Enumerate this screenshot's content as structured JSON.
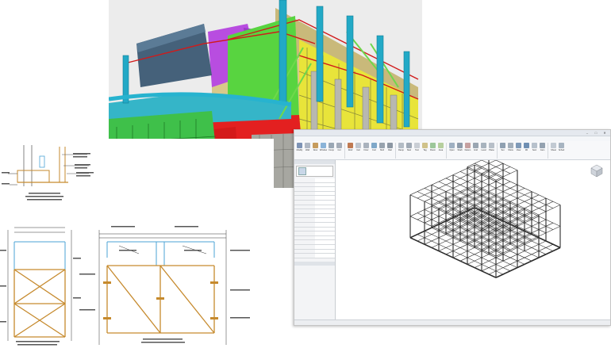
{
  "revit": {
    "title": "",
    "window_buttons": [
      "–",
      "□",
      "✕"
    ],
    "ribbon_tabs": [],
    "tools": [
      {
        "icon": "modify-icon",
        "label": "Modify",
        "color": "#7d93b5"
      },
      {
        "icon": "wall-icon",
        "label": "Wall",
        "color": "#b0b8c4"
      },
      {
        "icon": "door-icon",
        "label": "Door",
        "color": "#c69c5d"
      },
      {
        "icon": "window-icon",
        "label": "Window",
        "color": "#8ab3d8"
      },
      {
        "icon": "component-icon",
        "label": "Comp",
        "color": "#9aa7b4"
      },
      {
        "icon": "column-icon",
        "label": "Col",
        "color": "#a5adb8"
      },
      {
        "icon": "roof-icon",
        "label": "Roof",
        "color": "#c07a52"
      },
      {
        "icon": "ceiling-icon",
        "label": "Ceil",
        "color": "#bfc6cf"
      },
      {
        "icon": "floor-icon",
        "label": "Floor",
        "color": "#a9b2bd"
      },
      {
        "icon": "curtain-icon",
        "label": "Curt",
        "color": "#7fa8c9"
      },
      {
        "icon": "mullion-icon",
        "label": "Mull",
        "color": "#98a3ae"
      },
      {
        "icon": "railing-icon",
        "label": "Rail",
        "color": "#8c97a3"
      },
      {
        "icon": "ramp-icon",
        "label": "Ramp",
        "color": "#b3bcc5"
      },
      {
        "icon": "stair-icon",
        "label": "Stair",
        "color": "#a0aab5"
      },
      {
        "icon": "text-icon",
        "label": "Text",
        "color": "#c9ced5"
      },
      {
        "icon": "tag-icon",
        "label": "Tag",
        "color": "#d0c28a"
      },
      {
        "icon": "room-icon",
        "label": "Room",
        "color": "#9cc79a"
      },
      {
        "icon": "area-icon",
        "label": "Area",
        "color": "#b6cf9e"
      },
      {
        "icon": "opening-icon",
        "label": "Open",
        "color": "#9fb0c2"
      },
      {
        "icon": "shaft-icon",
        "label": "Shaft",
        "color": "#8e9cab"
      },
      {
        "icon": "datum-icon",
        "label": "Datum",
        "color": "#c6a0a0"
      },
      {
        "icon": "grid-icon",
        "label": "Grid",
        "color": "#9aa6b2"
      },
      {
        "icon": "level-icon",
        "label": "Level",
        "color": "#a8b3be"
      },
      {
        "icon": "ref-plane-icon",
        "label": "Plane",
        "color": "#b7bfc8"
      },
      {
        "icon": "set-icon",
        "label": "Set",
        "color": "#8fa0b1"
      },
      {
        "icon": "show-icon",
        "label": "Show",
        "color": "#a3afbb"
      },
      {
        "icon": "viewer-icon",
        "label": "View",
        "color": "#7f9ab8"
      },
      {
        "icon": "3d-icon",
        "label": "3D",
        "color": "#6f8fb3"
      },
      {
        "icon": "section-icon",
        "label": "Sect",
        "color": "#b7c1cc"
      },
      {
        "icon": "camera-icon",
        "label": "Cam",
        "color": "#94a2b0"
      },
      {
        "icon": "sheet-icon",
        "label": "Sheet",
        "color": "#c2cad3"
      },
      {
        "icon": "schedule-icon",
        "label": "Sched",
        "color": "#a7b4c1"
      }
    ],
    "group_names": [],
    "properties": {
      "header": "",
      "type_name": "",
      "rows": [
        {
          "k": "",
          "v": ""
        },
        {
          "k": "",
          "v": ""
        },
        {
          "k": "",
          "v": ""
        },
        {
          "k": "",
          "v": ""
        },
        {
          "k": "",
          "v": ""
        },
        {
          "k": "",
          "v": ""
        },
        {
          "k": "",
          "v": ""
        },
        {
          "k": "",
          "v": ""
        },
        {
          "k": "",
          "v": ""
        },
        {
          "k": "",
          "v": ""
        },
        {
          "k": "",
          "v": ""
        },
        {
          "k": "",
          "v": ""
        },
        {
          "k": "",
          "v": ""
        },
        {
          "k": "",
          "v": ""
        },
        {
          "k": "",
          "v": ""
        },
        {
          "k": "",
          "v": ""
        },
        {
          "k": "",
          "v": ""
        },
        {
          "k": "",
          "v": ""
        }
      ]
    },
    "browser": {
      "header": "",
      "items": [
        "",
        "",
        "",
        "",
        "",
        "",
        "",
        ""
      ]
    },
    "status_text": ""
  },
  "drawings": {
    "labels": {}
  }
}
